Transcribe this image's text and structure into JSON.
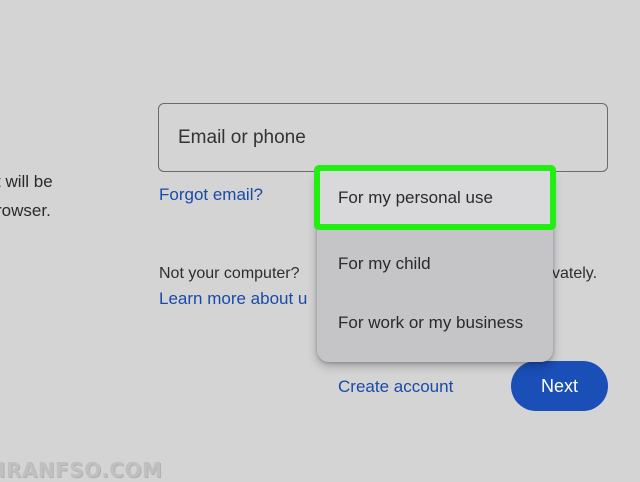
{
  "intro_text": {
    "line1": "t will be",
    "line2": "rowser."
  },
  "email_field": {
    "placeholder": "Email or phone",
    "value": ""
  },
  "forgot_email_label": "Forgot email?",
  "notice": {
    "text": "Not your computer?",
    "text_end": "vately."
  },
  "learn_more_label": "Learn more about u",
  "create_account": {
    "label": "Create account",
    "menu_items": [
      {
        "label": "For my personal use",
        "highlighted": true
      },
      {
        "label": "For my child",
        "highlighted": false
      },
      {
        "label": "For work or my business",
        "highlighted": false
      }
    ]
  },
  "next_label": "Next",
  "watermark": "IRANFSO.COM",
  "colors": {
    "background": "#d4d4d4",
    "link": "#1a4aa8",
    "primary_button": "#1a4fb8",
    "menu": "#c5c5c8",
    "highlight_outline": "#22ee12"
  }
}
